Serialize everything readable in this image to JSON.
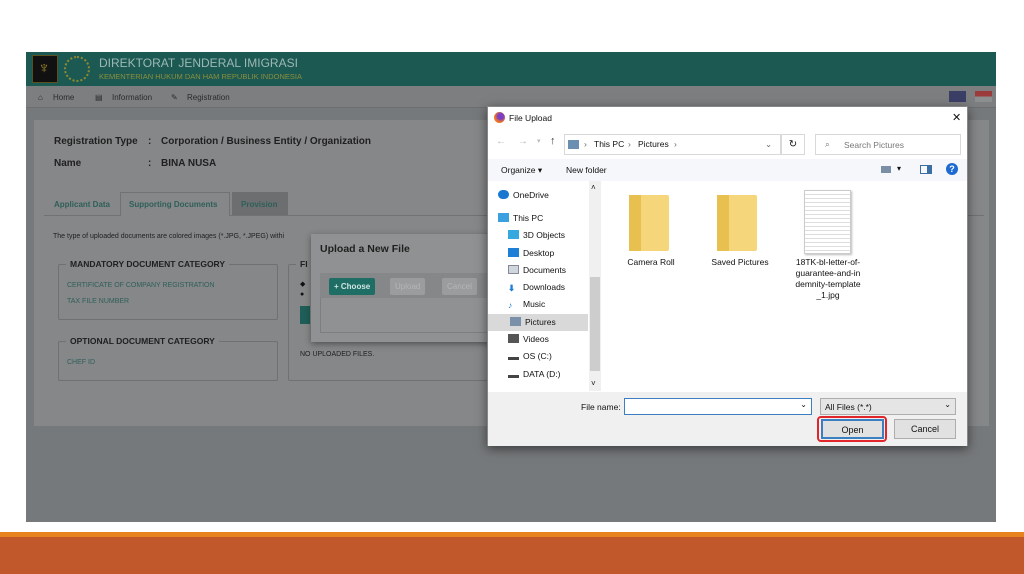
{
  "site": {
    "title": "DIREKTORAT JENDERAL IMIGRASI",
    "subtitle": "KEMENTERIAN HUKUM DAN HAM REPUBLIK INDONESIA"
  },
  "nav": [
    "Home",
    "Information",
    "Registration"
  ],
  "registration": {
    "type_label": "Registration Type",
    "type_value": "Corporation / Business Entity / Organization",
    "name_label": "Name",
    "name_value": "BINA NUSA",
    "sep": ":"
  },
  "tabs": [
    "Applicant Data",
    "Supporting Documents",
    "Provision"
  ],
  "note": "The type of uploaded documents are colored images (*.JPG, *.JPEG) withi",
  "mandatory": {
    "title": "MANDATORY DOCUMENT CATEGORY",
    "items": [
      "CERTIFICATE OF COMPANY REGISTRATION",
      "TAX FILE NUMBER"
    ]
  },
  "optional": {
    "title": "OPTIONAL DOCUMENT CATEGORY",
    "items": [
      "CHEF ID"
    ]
  },
  "files": {
    "title": "FI",
    "empty": "NO UPLOADED FILES."
  },
  "upload_modal": {
    "title": "Upload a New File",
    "choose": "+ Choose",
    "upload": "Upload",
    "cancel": "Cancel"
  },
  "dialog": {
    "title": "File Upload",
    "close": "✕",
    "breadcrumb": [
      "This PC",
      "Pictures"
    ],
    "search_placeholder": "Search Pictures",
    "organize": "Organize ▾",
    "new_folder": "New folder",
    "sidebar": [
      "OneDrive",
      "This PC",
      "3D Objects",
      "Desktop",
      "Documents",
      "Downloads",
      "Music",
      "Pictures",
      "Videos",
      "OS (C:)",
      "DATA (D:)"
    ],
    "selected_sidebar": "Pictures",
    "items": [
      {
        "name": "Camera Roll",
        "type": "folder"
      },
      {
        "name": "Saved Pictures",
        "type": "folder"
      },
      {
        "name": "18TK-bl-letter-of-guarantee-and-indemnity-template_1.jpg",
        "type": "image"
      }
    ],
    "filename_label": "File name:",
    "filename_value": "",
    "filter": "All Files (*.*)",
    "open": "Open",
    "cancel": "Cancel"
  },
  "colors": {
    "teal": "#2aa197",
    "orange": "#e8821e",
    "rust": "#c0582c",
    "highlight": "#e0262a"
  }
}
